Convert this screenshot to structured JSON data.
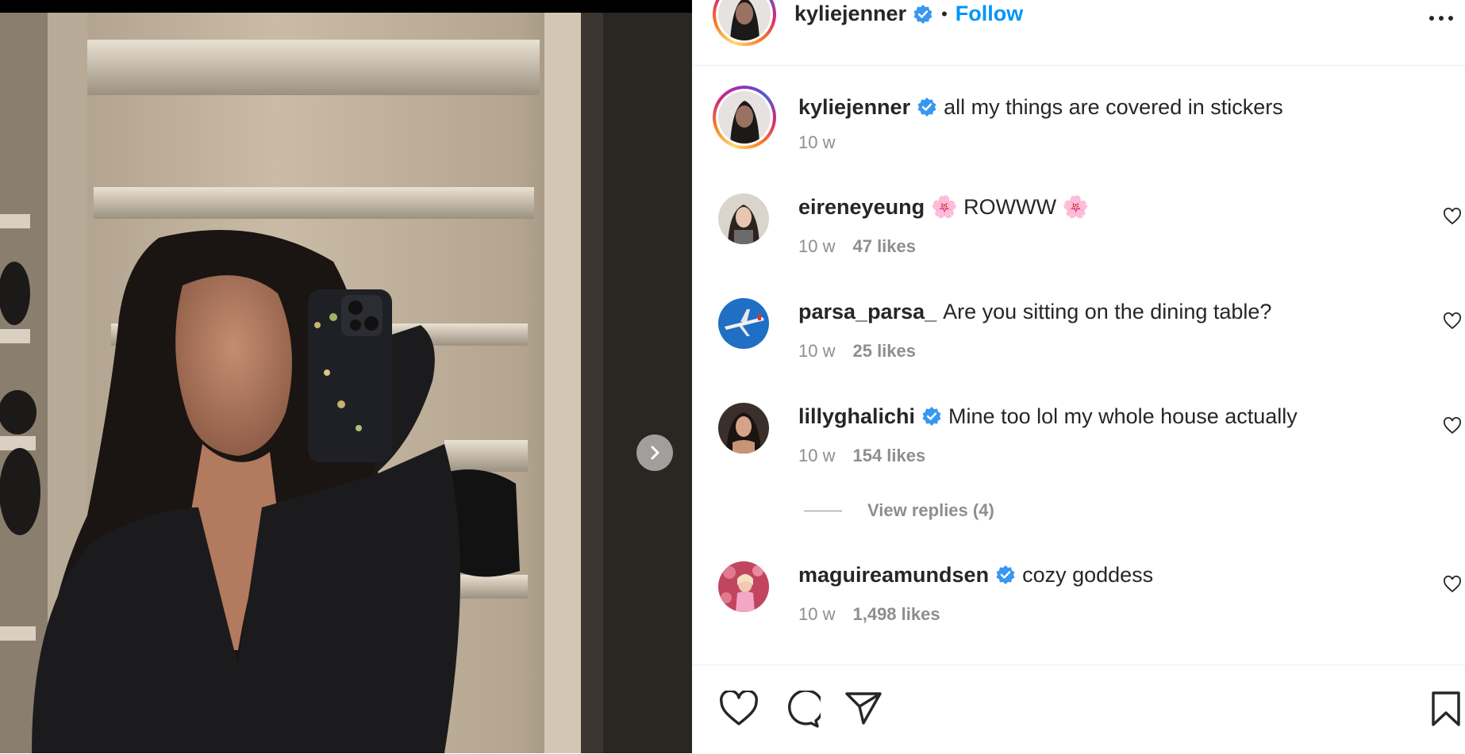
{
  "post": {
    "author": "kyliejenner",
    "follow_label": "Follow",
    "separator": "•",
    "caption": "all my things are covered in stickers",
    "caption_time": "10 w"
  },
  "comments": [
    {
      "user": "eireneyeung",
      "verified": false,
      "text": "🌸 ROWWW 🌸",
      "time": "10 w",
      "likes": "47 likes"
    },
    {
      "user": "parsa_parsa_",
      "verified": false,
      "text": "Are you sitting on the dining table?",
      "time": "10 w",
      "likes": "25 likes"
    },
    {
      "user": "lillyghalichi",
      "verified": true,
      "text": "Mine too lol my whole house actually",
      "time": "10 w",
      "likes": "154 likes"
    },
    {
      "user": "maguireamundsen",
      "verified": true,
      "text": "cozy goddess",
      "time": "10 w",
      "likes": "1,498 likes"
    }
  ],
  "view_replies": "View replies (4)",
  "icons": {
    "verified": "verified-badge-icon",
    "more": "more-options-icon",
    "next": "chevron-right-icon",
    "like": "heart-icon",
    "comment": "comment-bubble-icon",
    "share": "paper-plane-icon",
    "save": "bookmark-icon"
  },
  "colors": {
    "accent": "#0095f6",
    "text": "#262626",
    "muted": "#8e8e8e",
    "verified": "#3897f0"
  }
}
